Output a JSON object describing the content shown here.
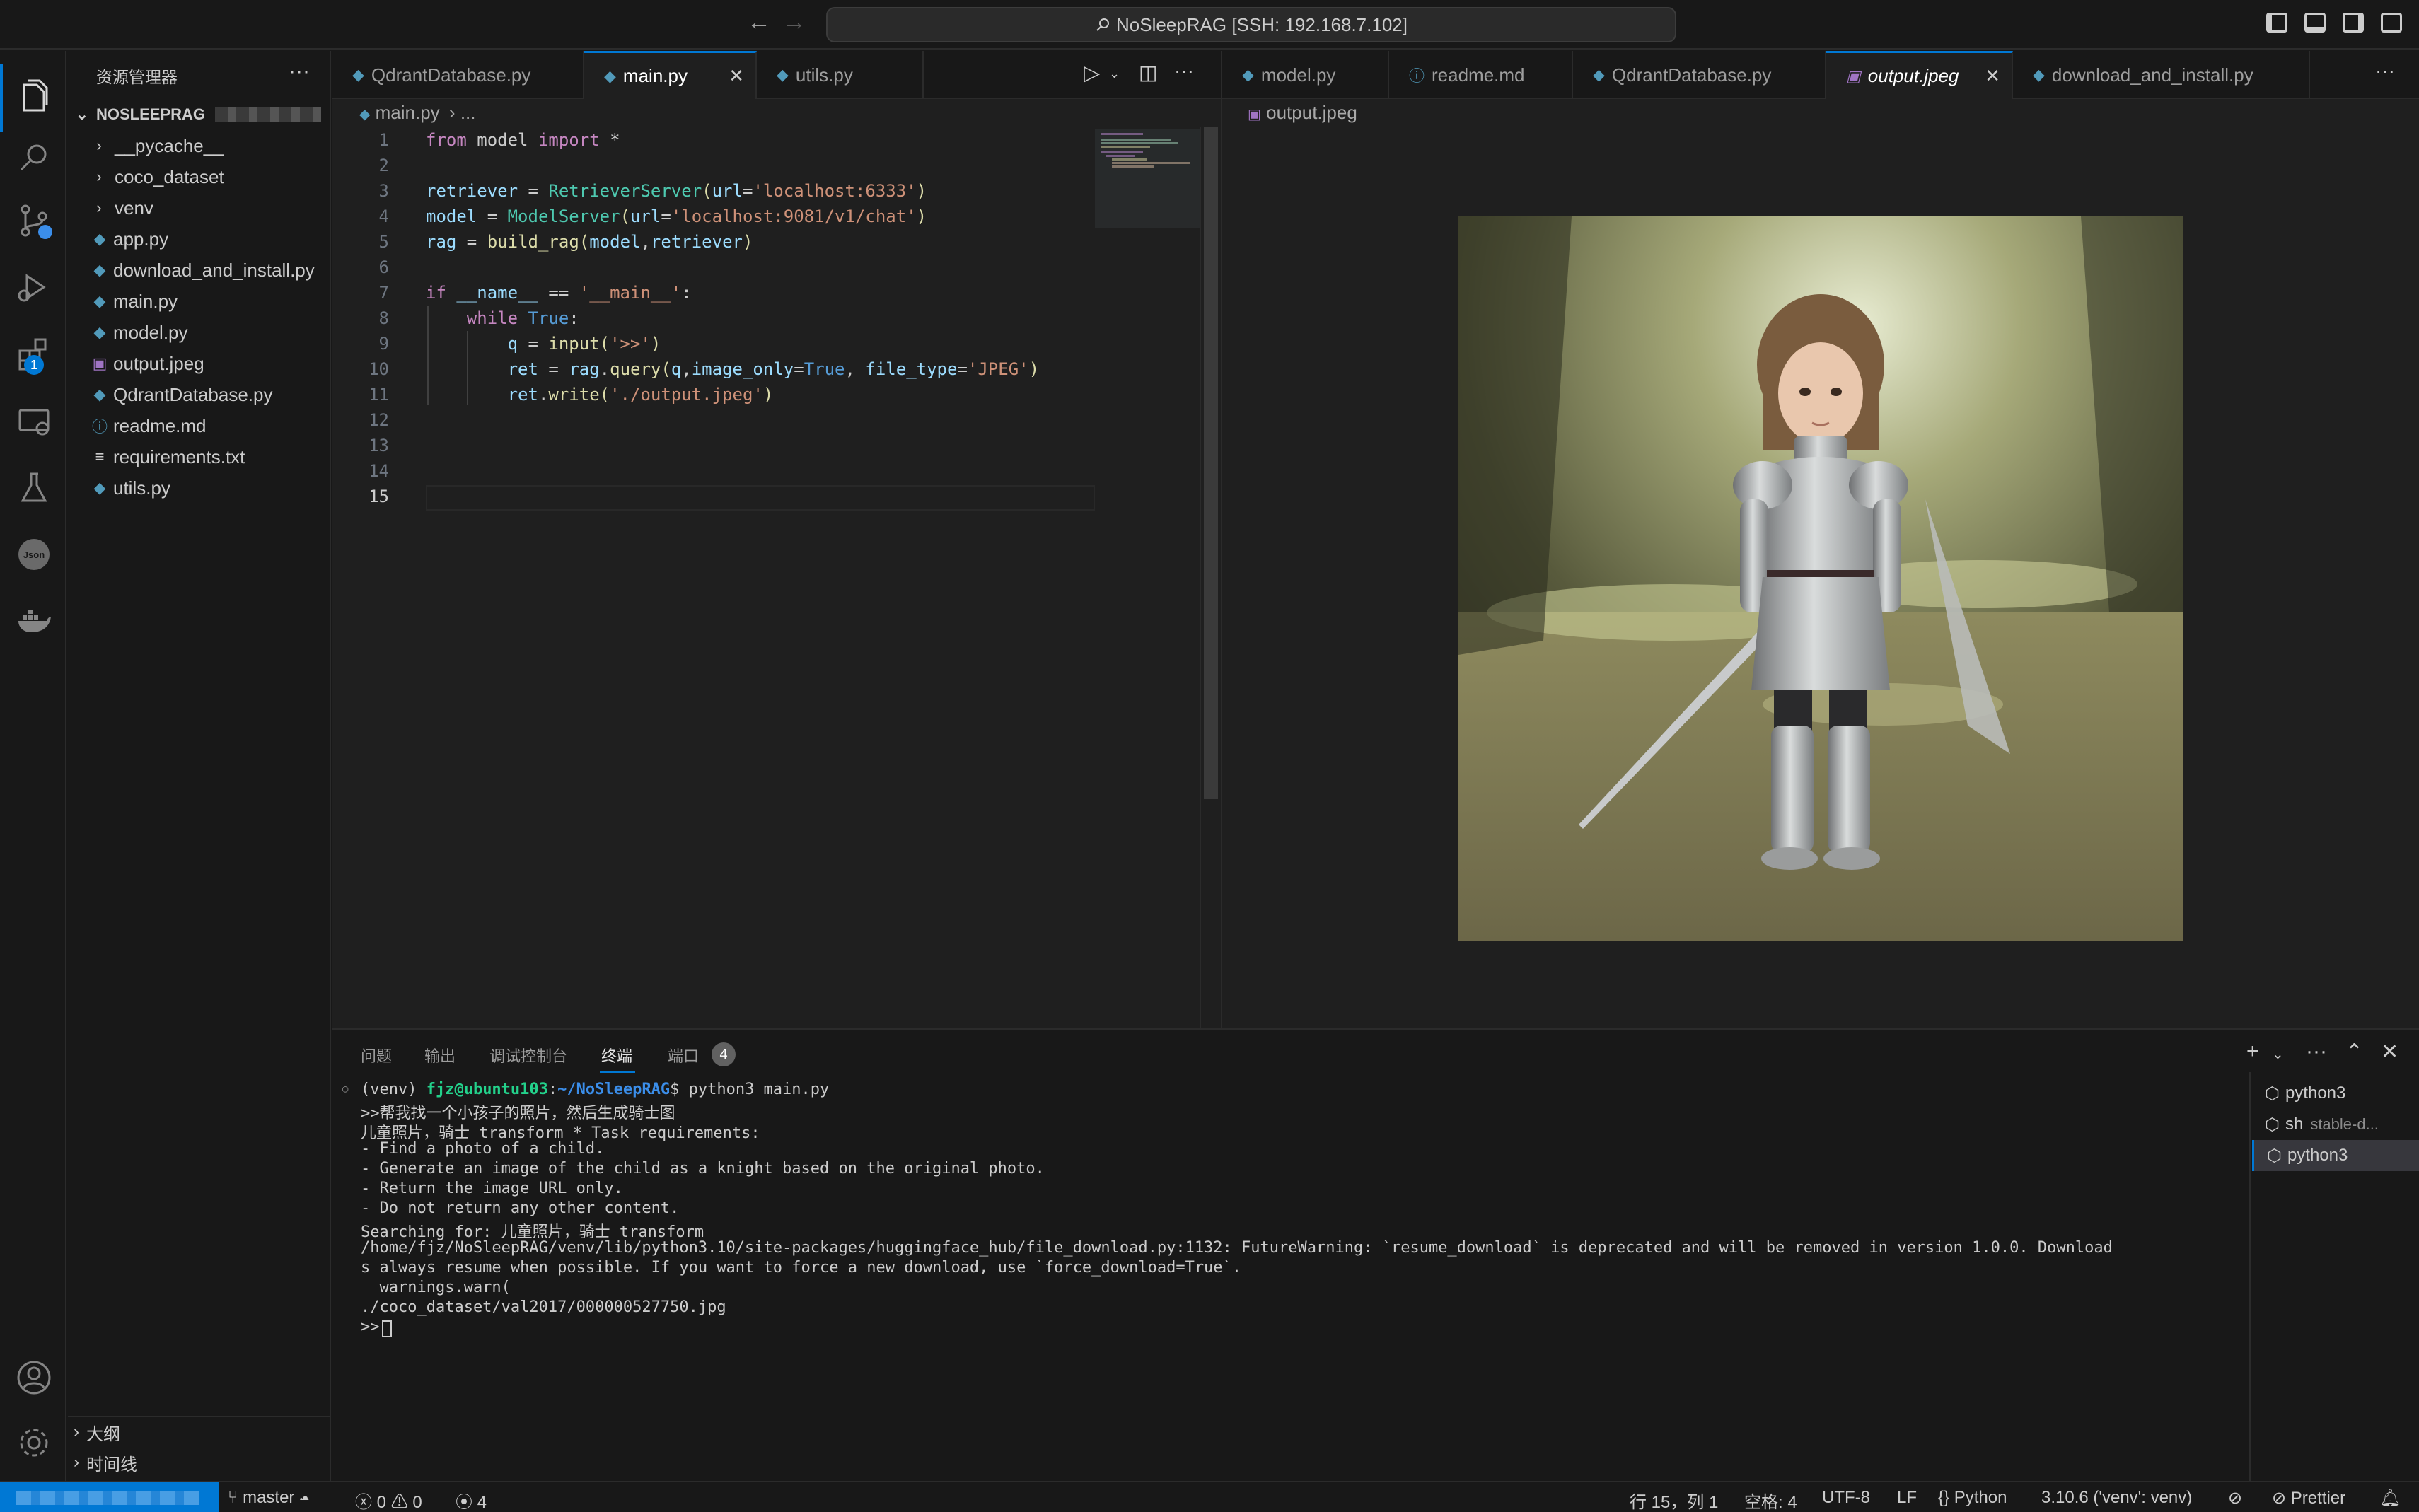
{
  "titlebar": {
    "command_center": "NoSleepRAG [SSH: 192.168.7.102]",
    "back_icon": "arrow-left-icon",
    "forward_icon": "arrow-right-icon"
  },
  "sidebar": {
    "title": "资源管理器",
    "more": "···",
    "root": "NOSLEEPRAG",
    "items": [
      {
        "label": "__pycache__",
        "type": "folder"
      },
      {
        "label": "coco_dataset",
        "type": "folder"
      },
      {
        "label": "venv",
        "type": "folder"
      },
      {
        "label": "app.py",
        "type": "python"
      },
      {
        "label": "download_and_install.py",
        "type": "python"
      },
      {
        "label": "main.py",
        "type": "python"
      },
      {
        "label": "model.py",
        "type": "python"
      },
      {
        "label": "output.jpeg",
        "type": "image"
      },
      {
        "label": "QdrantDatabase.py",
        "type": "python"
      },
      {
        "label": "readme.md",
        "type": "info"
      },
      {
        "label": "requirements.txt",
        "type": "text"
      },
      {
        "label": "utils.py",
        "type": "python"
      }
    ],
    "outline": "大纲",
    "timeline": "时间线"
  },
  "editor1": {
    "tabs": [
      "QdrantDatabase.py",
      "main.py",
      "utils.py"
    ],
    "active_tab": "main.py",
    "breadcrumb": "main.py",
    "breadcrumb_more": "...",
    "line_numbers": [
      "1",
      "2",
      "3",
      "4",
      "5",
      "6",
      "7",
      "8",
      "9",
      "10",
      "11",
      "12",
      "13",
      "14",
      "15"
    ],
    "code": {
      "l1": [
        "from",
        "model",
        "import",
        "*"
      ],
      "l3": [
        "retriever",
        "RetrieverServer",
        "url",
        "'localhost:6333'"
      ],
      "l4": [
        "model",
        "ModelServer",
        "url",
        "'localhost:9081/v1/chat'"
      ],
      "l5": [
        "rag",
        "build_rag",
        "model",
        "retriever"
      ],
      "l7": [
        "if",
        "__name__",
        "'__main__'"
      ],
      "l8": [
        "while",
        "True"
      ],
      "l9": [
        "q",
        "input",
        "'>>'"
      ],
      "l10": [
        "ret",
        "rag",
        "query",
        "q",
        "image_only",
        "True",
        "file_type",
        "'JPEG'"
      ],
      "l11": [
        "ret",
        "write",
        "'./output.jpeg'"
      ]
    }
  },
  "editor2": {
    "tabs": [
      "model.py",
      "readme.md",
      "QdrantDatabase.py",
      "output.jpeg",
      "download_and_install.py"
    ],
    "active_tab": "output.jpeg",
    "breadcrumb": "output.jpeg"
  },
  "panel": {
    "tabs": [
      "问题",
      "输出",
      "调试控制台",
      "终端",
      "端口"
    ],
    "active_tab": "终端",
    "ports_count": "4",
    "terminal": {
      "prompt_venv": "(venv) ",
      "prompt_user": "fjz@ubuntu103",
      "prompt_colon": ":",
      "prompt_path": "~/NoSleepRAG",
      "prompt_cmd": "$ python3 main.py",
      "lines": [
        ">>帮我找一个小孩子的照片，然后生成骑士图",
        "儿童照片，骑士 transform * Task requirements:",
        "- Find a photo of a child.",
        "- Generate an image of the child as a knight based on the original photo.",
        "- Return the image URL only.",
        "- Do not return any other content.",
        "Searching for: 儿童照片，骑士 transform",
        "/home/fjz/NoSleepRAG/venv/lib/python3.10/site-packages/huggingface_hub/file_download.py:1132: FutureWarning: `resume_download` is deprecated and will be removed in version 1.0.0. Download",
        "s always resume when possible. If you want to force a new download, use `force_download=True`.",
        "  warnings.warn(",
        "./coco_dataset/val2017/000000527750.jpg",
        ">>"
      ]
    },
    "terminal_list": [
      {
        "name": "python3",
        "sub": ""
      },
      {
        "name": "sh",
        "sub": "stable-d..."
      },
      {
        "name": "python3",
        "sub": ""
      }
    ]
  },
  "statusbar": {
    "branch": "master",
    "errors": "0",
    "warnings": "0",
    "ports": "4",
    "position": "行 15，列 1",
    "spaces": "空格: 4",
    "encoding": "UTF-8",
    "eol": "LF",
    "language": "Python",
    "interpreter": "3.10.6 ('venv': venv)",
    "prettier": "Prettier"
  },
  "colors": {
    "accent": "#0078d4",
    "background": "#1f1f1f",
    "sidebar": "#181818"
  }
}
